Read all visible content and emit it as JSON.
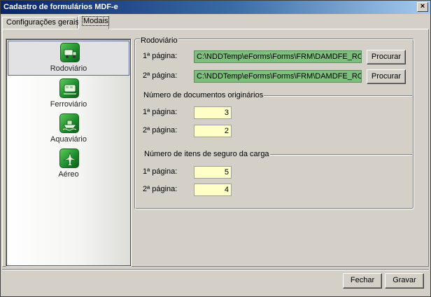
{
  "window": {
    "title": "Cadastro de formulários MDF-e",
    "close_glyph": "×"
  },
  "tabs": [
    {
      "label": "Configurações gerais"
    },
    {
      "label": "Modais"
    }
  ],
  "sidebar": {
    "items": [
      {
        "label": "Rodoviário",
        "icon": "truck-icon",
        "selected": true
      },
      {
        "label": "Ferroviário",
        "icon": "train-icon",
        "selected": false
      },
      {
        "label": "Aquaviário",
        "icon": "ship-icon",
        "selected": false
      },
      {
        "label": "Aéreo",
        "icon": "airplane-icon",
        "selected": false
      }
    ]
  },
  "rodoviario": {
    "title": "Rodoviário",
    "page1_label": "1ª página:",
    "page1_path": "C:\\NDDTemp\\eForms\\Forms\\FRM\\DAMDFE_ROD",
    "page2_label": "2ª página:",
    "page2_path": "C:\\NDDTemp\\eForms\\Forms\\FRM\\DAMDFE_ROD",
    "browse_label": "Procurar"
  },
  "documentos": {
    "title": "Número de documentos originários",
    "page1_label": "1ª página:",
    "page1_value": "3",
    "page2_label": "2ª página:",
    "page2_value": "2"
  },
  "seguro": {
    "title": "Número de itens de seguro da carga",
    "page1_label": "1ª página:",
    "page1_value": "5",
    "page2_label": "2ª página:",
    "page2_value": "4"
  },
  "footer": {
    "close_label": "Fechar",
    "save_label": "Gravar"
  },
  "colors": {
    "path_field_bg": "#7ebf7e",
    "num_field_bg": "#ffffc8",
    "title_gradient_start": "#0a246a"
  }
}
